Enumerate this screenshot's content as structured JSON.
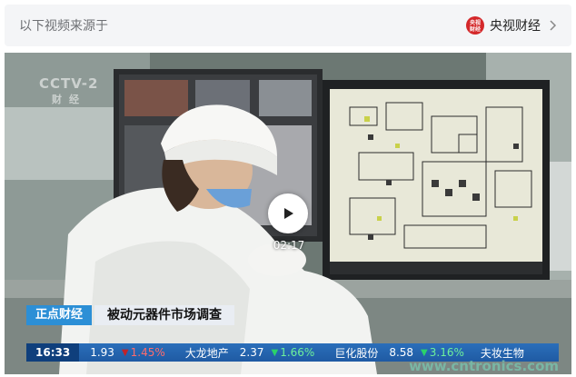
{
  "source_bar": {
    "label": "以下视频来源于",
    "channel_name": "央视财经",
    "channel_logo_text": "央视\n财经",
    "logo_color": "#d4282a"
  },
  "video": {
    "duration": "02:17",
    "cctv_logo": "CCTV-2",
    "cctv_sub": "财经",
    "program_tag": "正点财经",
    "headline": "被动元器件市场调查",
    "ticker": {
      "time": "16:33",
      "items": [
        {
          "value": "1.93",
          "direction": "down",
          "change": "1.45%"
        },
        {
          "name": "大龙地产",
          "value": "2.37",
          "direction": "up",
          "change": "1.66%"
        },
        {
          "name": "巨化股份",
          "value": "8.58",
          "direction": "up",
          "change": "3.16%"
        },
        {
          "name": "夫妆生物"
        }
      ]
    },
    "watermark": "www.cntronics.com"
  }
}
